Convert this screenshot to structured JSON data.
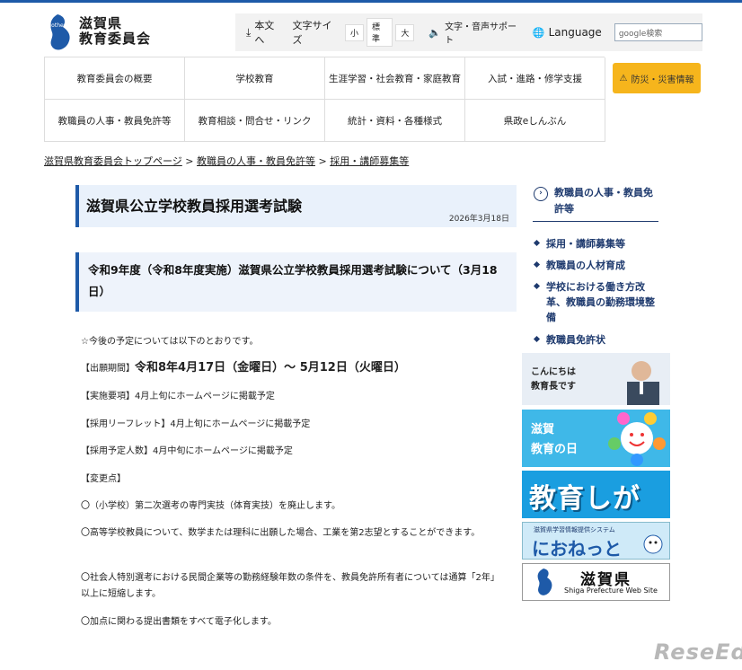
{
  "header": {
    "logo_line1": "滋賀県",
    "logo_line2": "教育委員会",
    "logo_mark_text": "Mother Lake",
    "skip_to_main": "本文へ",
    "font_size_label": "文字サイズ",
    "font_sizes": [
      "小",
      "標準",
      "大"
    ],
    "voice_support": "文字・音声サポート",
    "language": "Language",
    "search_placeholder": "google検索"
  },
  "gnav": [
    "教育委員会の概要",
    "学校教育",
    "生涯学習・社会教育・家庭教育",
    "入試・進路・修学支援",
    "教職員の人事・教員免許等",
    "教育相談・問合せ・リンク",
    "統計・資料・各種様式",
    "県政eしんぶん"
  ],
  "disaster_label": "防災・災害情報",
  "breadcrumb": [
    "滋賀県教育委員会トップページ",
    "教職員の人事・教員免許等",
    "採用・講師募集等"
  ],
  "breadcrumb_sep": ">",
  "page": {
    "title": "滋賀県公立学校教員採用選考試験",
    "date": "2026年3月18日",
    "subtitle": "令和9年度（令和8年度実施）滋賀県公立学校教員採用選考試験について（3月18日）",
    "intro": "☆今後の予定については以下のとおりです。",
    "application_label": "【出願期間】",
    "application_value": "令和8年4月17日（金曜日）～ 5月12日（火曜日）",
    "lines": [
      "【実施要項】4月上旬にホームページに掲載予定",
      "【採用リーフレット】4月上旬にホームページに掲載予定",
      "【採用予定人数】4月中旬にホームページに掲載予定",
      "【変更点】",
      "〇（小学校）第二次選考の専門実技（体育実技）を廃止します。",
      "〇高等学校教員について、数学または理科に出願した場合、工業を第2志望とすることができます。",
      "〇社会人特別選考における民間企業等の勤務経験年数の条件を、教員免許所有者については通算「2年」以上に短縮します。",
      "〇加点に関わる提出書類をすべて電子化します。"
    ]
  },
  "sidebar": {
    "heading": "教職員の人事・教員免許等",
    "items": [
      "採用・講師募集等",
      "教職員の人材育成",
      "学校における働き方改革、教職員の勤務環境整備",
      "教職員免許状"
    ],
    "banners": {
      "superintendent_line1": "こんにちは",
      "superintendent_line2": "教育長です",
      "edu_day_line1": "滋賀",
      "edu_day_line2": "教育の日",
      "kyoiku_shiga": "教育しが",
      "nionet_top": "滋賀県学習情報提供システム",
      "nionet": "におねっと",
      "pref_name": "滋賀県",
      "pref_en": "Shiga Prefecture Web Site"
    }
  },
  "watermark": "ReseEd",
  "colors": {
    "brand": "#1e5aa8",
    "disaster": "#f6b51c",
    "nav_text": "#1e3a6e"
  }
}
